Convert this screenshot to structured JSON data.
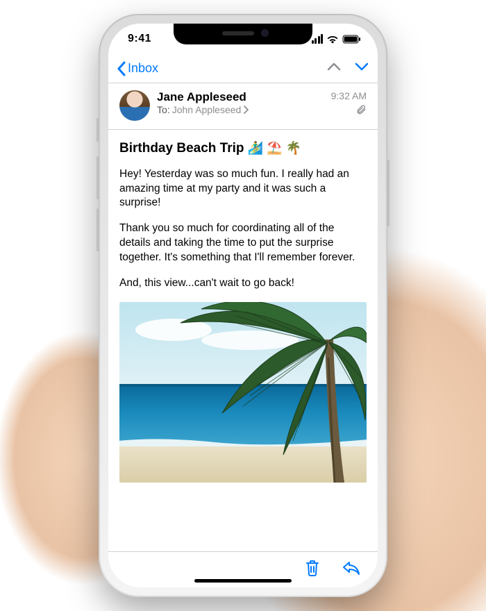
{
  "status": {
    "time": "9:41"
  },
  "nav": {
    "back_label": "Inbox"
  },
  "message": {
    "sender": "Jane Appleseed",
    "to_label": "To:",
    "recipient": "John Appleseed",
    "timestamp": "9:32 AM",
    "subject": "Birthday Beach Trip",
    "subject_emoji": "🏄‍♂️ ⛱️ 🌴",
    "body": {
      "p1": "Hey! Yesterday was so much fun. I really had an amazing time at my party and it was such a surprise!",
      "p2": "Thank you so much for coordinating all of the details and taking the time to put the surprise together. It's something that I'll remember forever.",
      "p3": "And, this view...can't wait to go back!"
    }
  },
  "icons": {
    "back": "chevron-left-icon",
    "prev": "chevron-up-icon",
    "next": "chevron-down-icon",
    "attach": "paperclip-icon",
    "trash": "trash-icon",
    "reply": "reply-icon"
  }
}
